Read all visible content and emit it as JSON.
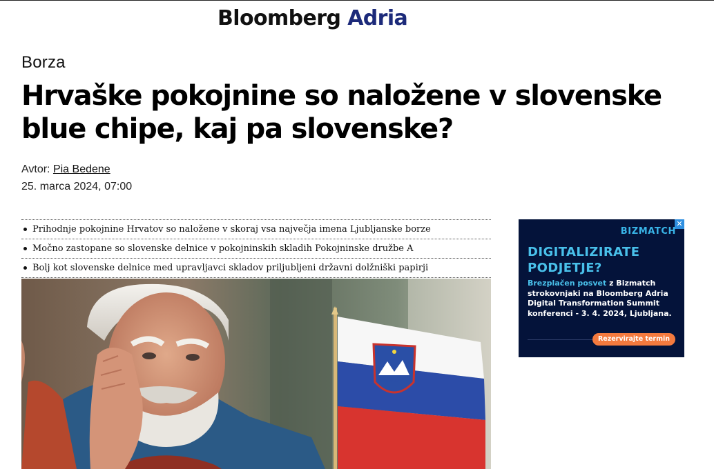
{
  "site": {
    "logo_part1": "Bloomberg",
    "logo_part2": "Adria"
  },
  "article": {
    "category": "Borza",
    "headline": "Hrvaške pokojnine so naložene v slovenske blue chipe, kaj pa slovenske?",
    "byline_prefix": "Avtor:",
    "author": "Pia Bedene",
    "date": "25. marca 2024, 07:00",
    "bullets": [
      "Prihodnje pokojnine Hrvatov so naložene v skoraj vsa največja imena Ljubljanske borze",
      "Močno zastopane so slovenske delnice v pokojninskih skladih Pokojninske družbe A",
      "Bolj kot slovenske delnice med upravljavci skladov priljubljeni državni dolžniški papirji"
    ]
  },
  "ad": {
    "close": "✕",
    "brand": "BIZMATCH",
    "headline_line1": "DIGITALIZIRATE",
    "headline_line2": "PODJETJE?",
    "body_highlight": "Brezplačen posvet",
    "body_text": " z Bizmatch strokovnjaki na Bloomberg Adria Digital Transformation Summit konferenci - 3. 4. 2024, Ljubljana.",
    "cta": "Rezervirajte termin"
  },
  "colors": {
    "brand_accent": "#1c2a7a",
    "ad_background": "#04133a",
    "ad_highlight": "#49c0ea",
    "ad_cta": "#f47a3e"
  }
}
